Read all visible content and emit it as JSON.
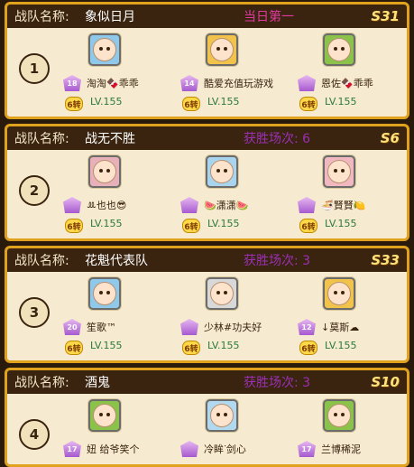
{
  "team_label": "战队名称:",
  "level_text": "LV.155",
  "turn_text": "6转",
  "teams": [
    {
      "rank": "1",
      "name": "象似日月",
      "stat": "当日第一",
      "stat_color": "#e03aa0",
      "server": "S31",
      "members": [
        {
          "name": "淘淘🍫乖乖",
          "badge": "18",
          "avatar_bg": "#8fc8e8",
          "level": "LV.155",
          "turn": "6转"
        },
        {
          "name": "酷爱充值玩游戏",
          "badge": "14",
          "avatar_bg": "#f2c34a",
          "level": "LV.155",
          "turn": "6转"
        },
        {
          "name": "恩佐🍫乖乖",
          "badge": "",
          "avatar_bg": "#8bc34a",
          "level": "LV.155",
          "turn": "6转"
        }
      ]
    },
    {
      "rank": "2",
      "name": "战无不胜",
      "stat": "获胜场次: 6",
      "stat_color": "#9b2fb5",
      "server": "S6",
      "members": [
        {
          "name": "ꔛ也也😎",
          "badge": "",
          "avatar_bg": "#e8b0b8",
          "level": "LV.155",
          "turn": "6转"
        },
        {
          "name": "🍉潇潇🍉",
          "badge": "",
          "avatar_bg": "#a8d4ee",
          "level": "LV.155",
          "turn": "6转"
        },
        {
          "name": "🍜賢賢🍋",
          "badge": "",
          "avatar_bg": "#f2b8c0",
          "level": "LV.155",
          "turn": "6转"
        }
      ]
    },
    {
      "rank": "3",
      "name": "花魁代表队",
      "stat": "获胜场次: 3",
      "stat_color": "#9b2fb5",
      "server": "S33",
      "members": [
        {
          "name": "笙歌™",
          "badge": "20",
          "avatar_bg": "#8fc8e8",
          "level": "LV.155",
          "turn": "6转"
        },
        {
          "name": "少林#功夫好",
          "badge": "",
          "avatar_bg": "#d8d8d8",
          "level": "LV.155",
          "turn": "6转"
        },
        {
          "name": "↓莫斯☁",
          "badge": "12",
          "avatar_bg": "#f2c34a",
          "level": "LV.155",
          "turn": "6转"
        }
      ]
    },
    {
      "rank": "4",
      "name": "酒鬼",
      "stat": "获胜场次: 3",
      "stat_color": "#9b2fb5",
      "server": "S10",
      "members": [
        {
          "name": "妞 给爷笑个",
          "badge": "17",
          "avatar_bg": "#8bc34a",
          "level": "",
          "turn": ""
        },
        {
          "name": "冷眸ᐝ剑心",
          "badge": "",
          "avatar_bg": "#b0d8ee",
          "level": "",
          "turn": ""
        },
        {
          "name": "兰博稀泥",
          "badge": "17",
          "avatar_bg": "#8bc34a",
          "level": "",
          "turn": ""
        }
      ]
    }
  ]
}
